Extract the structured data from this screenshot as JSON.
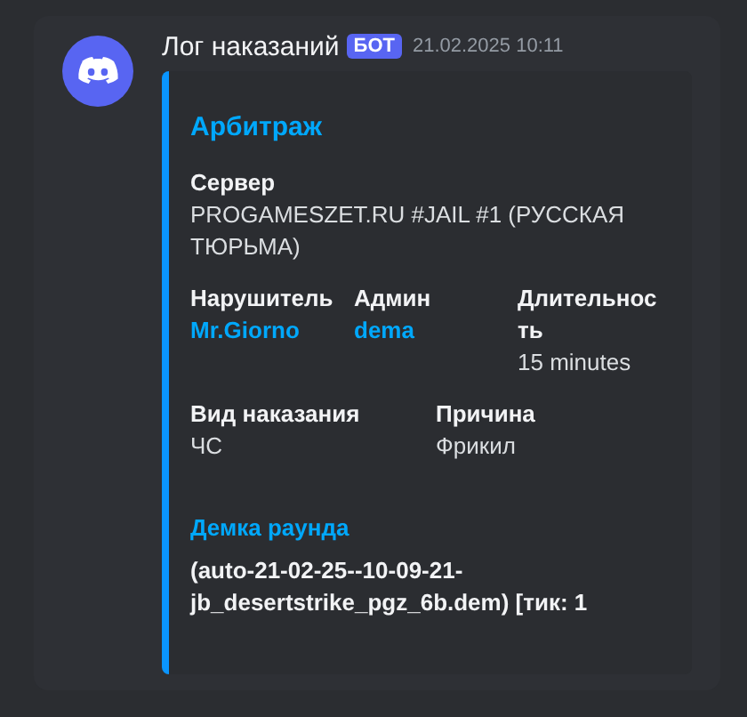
{
  "message": {
    "author": "Лог наказаний",
    "badge": "БОТ",
    "timestamp": "21.02.2025 10:11",
    "embed": {
      "title": "Арбитраж",
      "fields": [
        {
          "name": "Сервер",
          "value": "PROGAMESZET.RU #JAIL #1 (РУССКАЯ ТЮРЬМА)",
          "kind": "text"
        },
        {
          "name": "Нарушитель",
          "value": "Mr.Giorno",
          "inline": true,
          "kind": "mention"
        },
        {
          "name": "Админ",
          "value": "dema",
          "inline": true,
          "kind": "mention"
        },
        {
          "name": "Длительность",
          "value": "15 minutes",
          "inline": true,
          "kind": "text"
        },
        {
          "name": "Вид наказания",
          "value": "ЧС",
          "inline": true,
          "kind": "text"
        },
        {
          "name": "Причина",
          "value": "Фрикил",
          "inline": true,
          "kind": "text"
        }
      ],
      "section": {
        "heading": "Демка раунда",
        "text": "(auto-21-02-25--10-09-21-jb_desertstrike_pgz_6b.dem) [тик: 1"
      }
    }
  }
}
